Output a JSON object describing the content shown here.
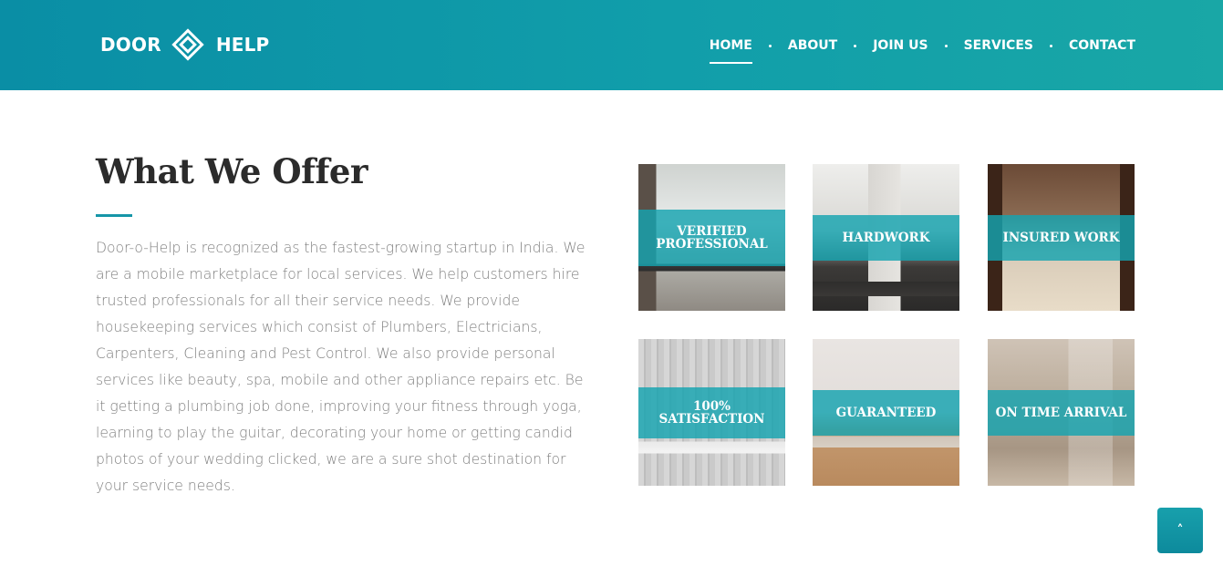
{
  "brand": {
    "left": "DOOR",
    "right": "HELP",
    "logo_icon": "diamond-logo-icon"
  },
  "nav": {
    "items": [
      "HOME",
      "ABOUT",
      "JOIN US",
      "SERVICES",
      "CONTACT"
    ],
    "active": "HOME"
  },
  "section": {
    "title": "What We Offer",
    "description": "Door-o-Help is recognized as the fastest-growing startup in India. We are a mobile marketplace for local services. We help customers hire trusted professionals for all their service needs. We provide housekeeping services which consist of Plumbers, Electricians, Carpenters, Cleaning and Pest Control. We also provide personal services like beauty, spa, mobile and other appliance repairs etc. Be it getting a plumbing job done, improving your fitness through yoga, learning to play the guitar, decorating your home or getting candid photos of your wedding clicked, we are a sure shot destination for your service needs."
  },
  "tiles": [
    {
      "label": "VERIFIED PROFESSIONAL"
    },
    {
      "label": "HARDWORK"
    },
    {
      "label": "INSURED WORK"
    },
    {
      "label": "100% SATISFACTION"
    },
    {
      "label": "GUARANTEED"
    },
    {
      "label": "ON TIME ARRIVAL"
    }
  ],
  "scroll_top": {
    "icon": "chevron-up-icon",
    "glyph": "˄"
  },
  "colors": {
    "header_start": "#0a8ea5",
    "header_end": "#19a7a6",
    "accent": "#1696a8"
  }
}
